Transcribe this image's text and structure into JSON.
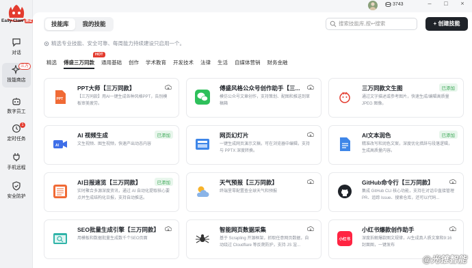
{
  "app": {
    "name": "Easy Claw",
    "name_tag": "测试"
  },
  "sidebar": {
    "items": [
      {
        "label": "对话",
        "icon": "chat-icon"
      },
      {
        "label": "技能商店",
        "icon": "sparkle-icon",
        "badge": "三方"
      },
      {
        "label": "数字员工",
        "icon": "bot-icon"
      },
      {
        "label": "定时任务",
        "icon": "clock-icon",
        "badge": "1"
      },
      {
        "label": "手机远程",
        "icon": "plug-icon"
      },
      {
        "label": "安全防护",
        "icon": "shield-icon"
      }
    ]
  },
  "status": {
    "credits": "3743"
  },
  "header": {
    "tabs": [
      "技能库",
      "我的技能"
    ],
    "search_placeholder": "搜索技能库,按↩搜索",
    "create_label": "+ 创建技能"
  },
  "hint": "精选专业技能、安全可靠、每周能力持续建设只启用一个。",
  "categories": [
    "精选",
    "傅盛三万同款",
    "通用基础",
    "创作",
    "学术教育",
    "开发技术",
    "法律",
    "生活",
    "自媒体营销",
    "财务金融"
  ],
  "hot_badge": "HOT",
  "cards": [
    {
      "title": "PPT大师【三万同款】",
      "desc": "【三万同款】用AI一键生成各种风格PPT，告别模板审美疲劳。",
      "icon": "ppt-icon",
      "added": ""
    },
    {
      "title": "傅盛风格公众号创作助手【三...",
      "desc": "模仿公众号文章创作，支持策划、配图和推送到草稿箱",
      "icon": "wechat-icon",
      "added": ""
    },
    {
      "title": "三万同款文生图",
      "desc": "通过文字描述或参考图片，快速生成/编辑高质量 JPEG 图像。",
      "icon": "image-gen-icon",
      "added": "已添加"
    },
    {
      "title": "AI 视频生成",
      "desc": "文生视频、图生视频，快速产出动态内容",
      "icon": "video-icon",
      "added": "已添加"
    },
    {
      "title": "网页幻灯片",
      "desc": "一键生成网页演示文稿，可在浏览器中编辑，支持与 PPTX 深度转换。",
      "icon": "slides-icon",
      "added": ""
    },
    {
      "title": "AI文本润色",
      "desc": "精准改写和润色文案，深度优化措辞与段落逻辑，生成高质量内容。",
      "icon": "doc-icon",
      "added": "已添加"
    },
    {
      "title": "AI日报速览【三万同款】",
      "desc": "实时聚合多源深度资讯，通过 AI 自动化提取核心要点并生成结构化日报，支持自动推送。",
      "icon": "news-icon",
      "added": "已添加"
    },
    {
      "title": "天气预报【三万同款】",
      "desc": "终端里零配置查全球天气和预报",
      "icon": "weather-icon",
      "added": ""
    },
    {
      "title": "GitHub命令行【三万同款】",
      "desc": "集成 GitHub CLI 核心功能，支持在对话中直接管理 PR、追踪 Issue、搜索仓库，还可以代码...",
      "icon": "github-icon",
      "added": ""
    },
    {
      "title": "SEO批量生成引擎【三万同款】",
      "desc": "用模板和数据批量生成数千个SEO页面",
      "icon": "seo-icon",
      "added": ""
    },
    {
      "title": "智能网页数据采集",
      "desc": "基于 Scrapling 开源框架，抓取任意网页数据，自动绕过 Cloudflare 等反爬防护，支持 JS 渲...",
      "icon": "spider-icon",
      "added": ""
    },
    {
      "title": "小红书爆款创作助手",
      "desc": "深度拆解爆款图文规律，AI生成真人质文案和9:16封面图，一键发布",
      "icon": "xhs-icon",
      "added": ""
    }
  ],
  "watermark": "@光锥智能",
  "colors": {
    "accent": "#1f2329",
    "hot": "#e33b2e",
    "added": "#3aa755"
  }
}
